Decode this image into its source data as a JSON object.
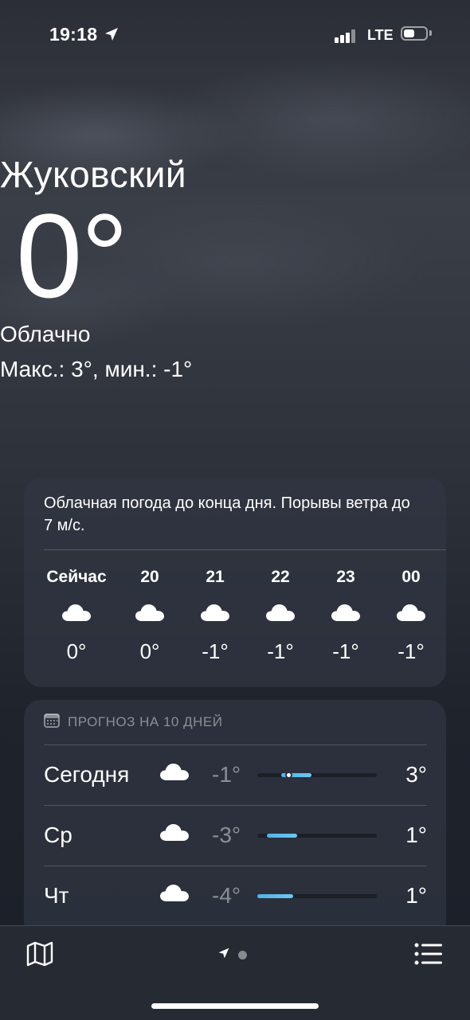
{
  "status_bar": {
    "time": "19:18",
    "network": "LTE",
    "location_icon": "location-arrow-icon",
    "signal_icon": "cellular-signal-icon",
    "battery_icon": "battery-icon"
  },
  "current": {
    "city": "Жуковский",
    "temperature": "0°",
    "condition": "Облачно",
    "high_low": "Макс.: 3°, мин.: -1°"
  },
  "hourly": {
    "summary": "Облачная погода до конца дня. Порывы ветра до 7 м/с.",
    "items": [
      {
        "label": "Сейчас",
        "icon": "cloud-icon",
        "temp": "0°"
      },
      {
        "label": "20",
        "icon": "cloud-icon",
        "temp": "0°"
      },
      {
        "label": "21",
        "icon": "cloud-icon",
        "temp": "-1°"
      },
      {
        "label": "22",
        "icon": "cloud-icon",
        "temp": "-1°"
      },
      {
        "label": "23",
        "icon": "cloud-icon",
        "temp": "-1°"
      },
      {
        "label": "00",
        "icon": "cloud-icon",
        "temp": "-1°"
      }
    ]
  },
  "forecast": {
    "header": "ПРОГНОЗ НА 10 ДНЕЙ",
    "header_icon": "calendar-icon",
    "days": [
      {
        "name": "Сегодня",
        "icon": "cloud-icon",
        "low": "-1°",
        "high": "3°",
        "bar_start": 0.2,
        "bar_end": 0.45,
        "current_marker": 0.26
      },
      {
        "name": "Ср",
        "icon": "cloud-icon",
        "low": "-3°",
        "high": "1°",
        "bar_start": 0.08,
        "bar_end": 0.33
      },
      {
        "name": "Чт",
        "icon": "cloud-icon",
        "low": "-4°",
        "high": "1°",
        "bar_start": 0.0,
        "bar_end": 0.3
      }
    ]
  },
  "tab_bar": {
    "map_icon": "map-icon",
    "location_icon": "location-arrow-icon",
    "list_icon": "list-icon",
    "page_count": 2,
    "current_page": 1
  },
  "colors": {
    "bar": "#5bbfee",
    "card": "#303642",
    "tabbar": "#252a33"
  }
}
